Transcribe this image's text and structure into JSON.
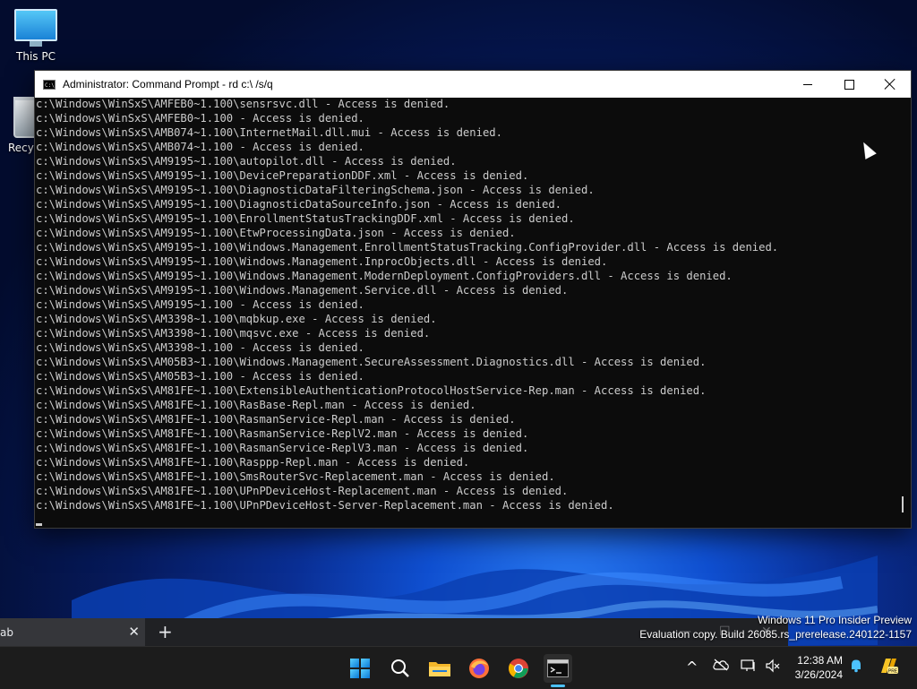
{
  "desktop": {
    "icons": [
      {
        "label": "This PC"
      },
      {
        "label": "Recyc"
      }
    ]
  },
  "window": {
    "title": "Administrator: Command Prompt - rd  c:\\ /s/q",
    "app_icon_text": "C:\\"
  },
  "console": {
    "lines": [
      "c:\\Windows\\WinSxS\\AMFEB0~1.100\\sensrsvc.dll - Access is denied.",
      "c:\\Windows\\WinSxS\\AMFEB0~1.100 - Access is denied.",
      "c:\\Windows\\WinSxS\\AMB074~1.100\\InternetMail.dll.mui - Access is denied.",
      "c:\\Windows\\WinSxS\\AMB074~1.100 - Access is denied.",
      "c:\\Windows\\WinSxS\\AM9195~1.100\\autopilot.dll - Access is denied.",
      "c:\\Windows\\WinSxS\\AM9195~1.100\\DevicePreparationDDF.xml - Access is denied.",
      "c:\\Windows\\WinSxS\\AM9195~1.100\\DiagnosticDataFilteringSchema.json - Access is denied.",
      "c:\\Windows\\WinSxS\\AM9195~1.100\\DiagnosticDataSourceInfo.json - Access is denied.",
      "c:\\Windows\\WinSxS\\AM9195~1.100\\EnrollmentStatusTrackingDDF.xml - Access is denied.",
      "c:\\Windows\\WinSxS\\AM9195~1.100\\EtwProcessingData.json - Access is denied.",
      "c:\\Windows\\WinSxS\\AM9195~1.100\\Windows.Management.EnrollmentStatusTracking.ConfigProvider.dll - Access is denied.",
      "c:\\Windows\\WinSxS\\AM9195~1.100\\Windows.Management.InprocObjects.dll - Access is denied.",
      "c:\\Windows\\WinSxS\\AM9195~1.100\\Windows.Management.ModernDeployment.ConfigProviders.dll - Access is denied.",
      "c:\\Windows\\WinSxS\\AM9195~1.100\\Windows.Management.Service.dll - Access is denied.",
      "c:\\Windows\\WinSxS\\AM9195~1.100 - Access is denied.",
      "c:\\Windows\\WinSxS\\AM3398~1.100\\mqbkup.exe - Access is denied.",
      "c:\\Windows\\WinSxS\\AM3398~1.100\\mqsvc.exe - Access is denied.",
      "c:\\Windows\\WinSxS\\AM3398~1.100 - Access is denied.",
      "c:\\Windows\\WinSxS\\AM05B3~1.100\\Windows.Management.SecureAssessment.Diagnostics.dll - Access is denied.",
      "c:\\Windows\\WinSxS\\AM05B3~1.100 - Access is denied.",
      "c:\\Windows\\WinSxS\\AM81FE~1.100\\ExtensibleAuthenticationProtocolHostService-Rep.man - Access is denied.",
      "c:\\Windows\\WinSxS\\AM81FE~1.100\\RasBase-Repl.man - Access is denied.",
      "c:\\Windows\\WinSxS\\AM81FE~1.100\\RasmanService-Repl.man - Access is denied.",
      "c:\\Windows\\WinSxS\\AM81FE~1.100\\RasmanService-ReplV2.man - Access is denied.",
      "c:\\Windows\\WinSxS\\AM81FE~1.100\\RasmanService-ReplV3.man - Access is denied.",
      "c:\\Windows\\WinSxS\\AM81FE~1.100\\Rasppp-Repl.man - Access is denied.",
      "c:\\Windows\\WinSxS\\AM81FE~1.100\\SmsRouterSvc-Replacement.man - Access is denied.",
      "c:\\Windows\\WinSxS\\AM81FE~1.100\\UPnPDeviceHost-Replacement.man - Access is denied.",
      "c:\\Windows\\WinSxS\\AM81FE~1.100\\UPnPDeviceHost-Server-Replacement.man - Access is denied."
    ]
  },
  "browser": {
    "tab_label": "ab",
    "tab_close": "✕",
    "new_tab": "+",
    "controls": [
      "—",
      "☐",
      "✕"
    ]
  },
  "watermark": {
    "line1": "Windows 11 Pro Insider Preview",
    "line2": "Evaluation copy. Build 26085.rs_prerelease.240122-1157"
  },
  "taskbar": {
    "icons": [
      "start-icon",
      "search-icon",
      "file-explorer-icon",
      "firefox-icon",
      "chrome-icon",
      "terminal-icon"
    ],
    "tray": {
      "chevron": "^",
      "clock_time": "12:38 AM",
      "clock_date": "3/26/2024"
    }
  },
  "colors": {
    "console_bg": "#0c0c0c",
    "console_fg": "#cccccc",
    "taskbar_bg": "#1c1c1c",
    "accent": "#4cc2ff"
  }
}
